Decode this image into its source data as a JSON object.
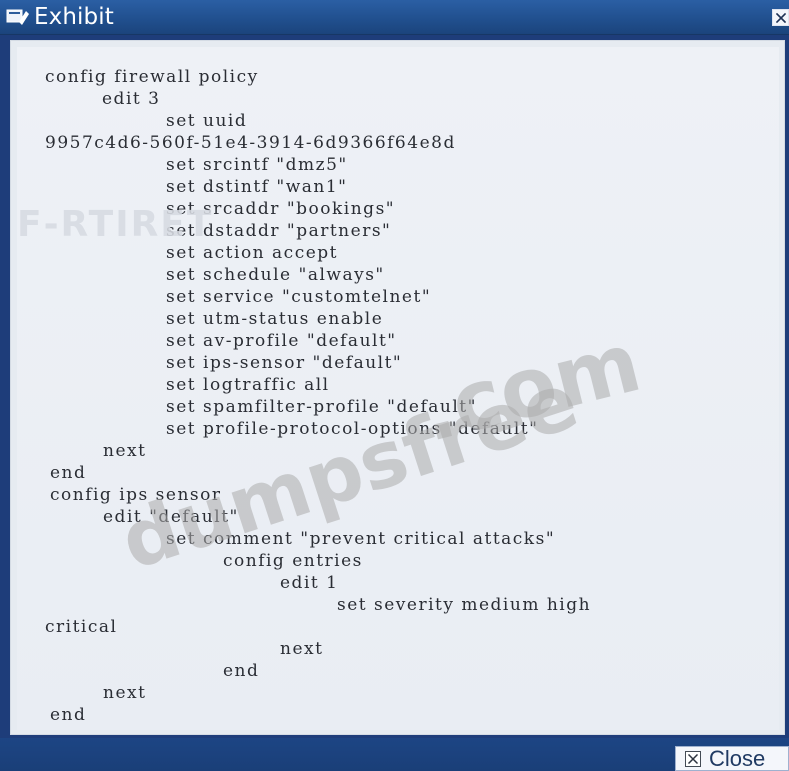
{
  "window": {
    "title": "Exhibit",
    "close_label": "Close"
  },
  "brand_watermark": "F‑RTIRET",
  "watermarks": {
    "dot_com": ".com",
    "dumps": "dumpsfree"
  },
  "terminal": {
    "lines": [
      "config firewall policy",
      "edit 3",
      "set uuid",
      "9957c4d6-560f-51e4-3914-6d9366f64e8d",
      "set srcintf \"dmz5\"",
      "set dstintf \"wan1\"",
      "set srcaddr \"bookings\"",
      "set dstaddr \"partners\"",
      "set action accept",
      "set schedule \"always\"",
      "set service \"customtelnet\"",
      "set utm-status enable",
      "set av-profile \"default\"",
      "set ips-sensor \"default\"",
      "set logtraffic all",
      "set spamfilter-profile \"default\"",
      "set profile-protocol-options \"default\"",
      "next",
      "end",
      "config ips sensor",
      "edit \"default\"",
      "set comment \"prevent critical attacks\"",
      "config entries",
      "edit 1",
      "set severity medium high",
      "critical",
      "next",
      "end",
      "next",
      "end"
    ]
  },
  "icons": {
    "window_icon": "window-icon",
    "close": "close-icon"
  },
  "colors": {
    "titlebar": "#21508f",
    "panel": "#e6ebf1",
    "text": "#2a2d34",
    "watermark": "#acacac"
  }
}
